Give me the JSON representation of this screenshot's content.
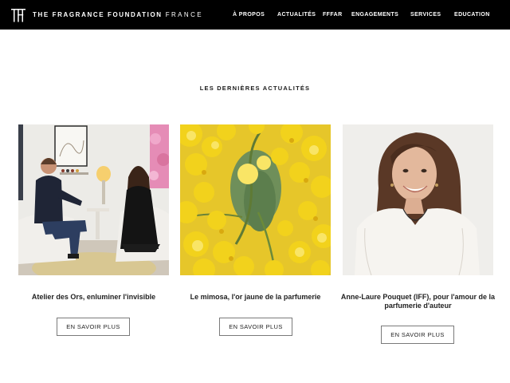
{
  "header": {
    "brand_main": "THE FRAGRANCE FOUNDATION",
    "brand_sub": "FRANCE",
    "logo_icon": "tff-monogram-icon",
    "nav": [
      {
        "label": "À PROPOS"
      },
      {
        "label": "ACTUALITÉS"
      },
      {
        "label": "FFFAR"
      },
      {
        "label": "ENGAGEMENTS"
      },
      {
        "label": "SERVICES"
      },
      {
        "label": "EDUCATION"
      }
    ]
  },
  "section": {
    "title": "LES DERNIÈRES ACTUALITÉS"
  },
  "articles": [
    {
      "title": "Atelier des Ors, enluminer l'invisible",
      "button": "EN SAVOIR PLUS",
      "image": "interview-photo"
    },
    {
      "title": "Le mimosa, l'or jaune de la parfumerie",
      "button": "EN SAVOIR PLUS",
      "image": "mimosa-flowers-photo"
    },
    {
      "title_line1": "Anne-Laure Pouquet (IFF), pour l'amour de la",
      "title_line2": "parfumerie d'auteur",
      "button": "EN SAVOIR PLUS",
      "image": "portrait-photo"
    }
  ],
  "colors": {
    "header_bg": "#000000",
    "text": "#1a1a1a",
    "button_border": "#7a7a7a",
    "mimosa_yellow": "#f2d21c"
  }
}
